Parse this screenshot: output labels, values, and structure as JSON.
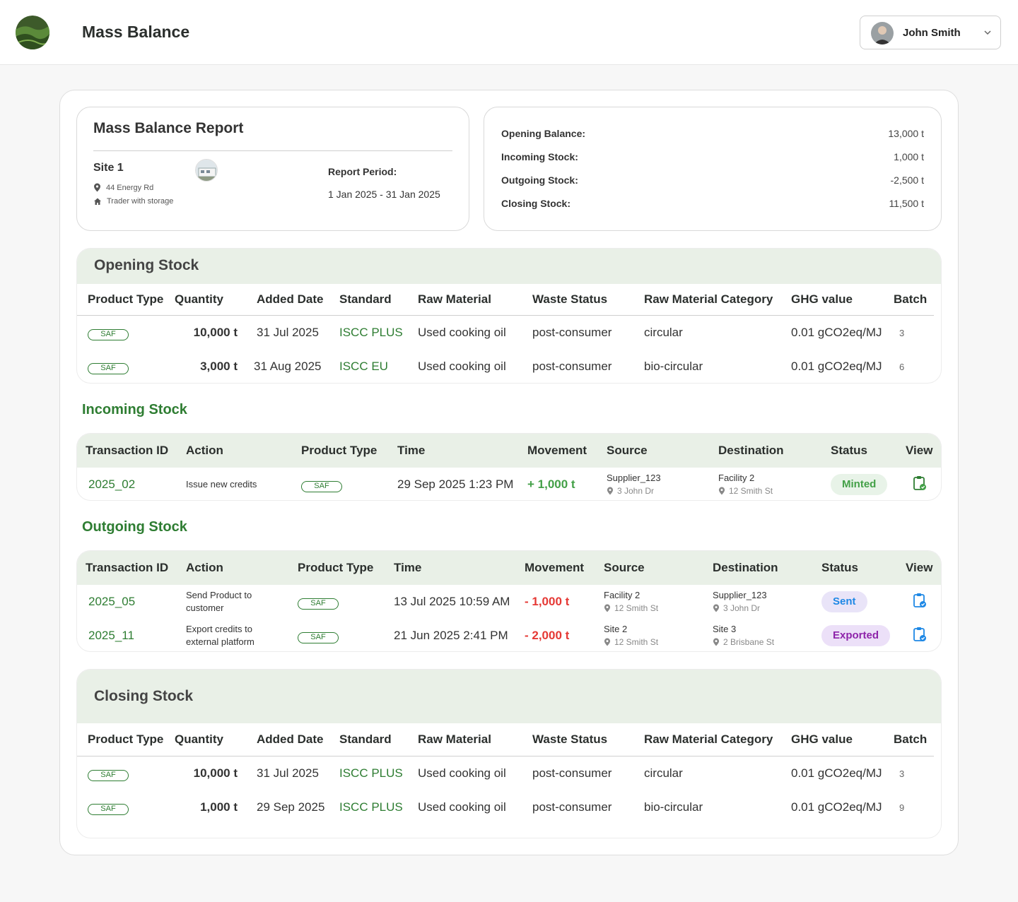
{
  "header": {
    "app_title": "Mass Balance",
    "user_name": "John Smith",
    "logo_icon": "landscape-logo",
    "avatar_icon": "user-avatar"
  },
  "report": {
    "title": "Mass Balance Report",
    "site_name": "Site 1",
    "address": "44 Energy Rd",
    "site_type": "Trader with storage",
    "period_label": "Report Period:",
    "period_value": "1 Jan 2025 - 31 Jan 2025"
  },
  "balance": [
    {
      "label": "Opening Balance:",
      "value": "13,000 t"
    },
    {
      "label": "Incoming Stock:",
      "value": "1,000 t"
    },
    {
      "label": "Outgoing Stock:",
      "value": "-2,500 t"
    },
    {
      "label": "Closing Stock:",
      "value": "11,500 t"
    }
  ],
  "stock_headers": [
    "Product Type",
    "Quantity",
    "Added Date",
    "Standard",
    "Raw Material",
    "Waste Status",
    "Raw Material Category",
    "GHG  value",
    "Batch"
  ],
  "opening": {
    "title": "Opening Stock",
    "rows": [
      {
        "type": "SAF",
        "qty": "10,000 t",
        "date": "31 Jul 2025",
        "standard": "ISCC PLUS",
        "raw": "Used cooking oil",
        "waste": "post-consumer",
        "cat": "circular",
        "ghg": "0.01 gCO2eq/MJ",
        "batch": "3"
      },
      {
        "type": "SAF",
        "qty": "3,000 t",
        "date": "31 Aug 2025",
        "standard": "ISCC EU",
        "raw": "Used cooking oil",
        "waste": "post-consumer",
        "cat": "bio-circular",
        "ghg": "0.01 gCO2eq/MJ",
        "batch": "6"
      }
    ]
  },
  "tx_headers": [
    "Transaction ID",
    "Action",
    "Product Type",
    "Time",
    "Movement",
    "Source",
    "Destination",
    "Status",
    "View"
  ],
  "incoming": {
    "title": "Incoming Stock",
    "rows": [
      {
        "id": "2025_02",
        "action": "Issue new credits",
        "type": "SAF",
        "time": "29 Sep 2025  1:23 PM",
        "movement": "+ 1,000 t",
        "src": "Supplier_123",
        "src_addr": "3 John Dr",
        "dst": "Facility 2",
        "dst_addr": "12 Smith St",
        "status": "Minted"
      }
    ]
  },
  "outgoing": {
    "title": "Outgoing Stock",
    "rows": [
      {
        "id": "2025_05",
        "action": "Send Product to customer",
        "type": "SAF",
        "time": "13 Jul 2025  10:59 AM",
        "movement": "- 1,000 t",
        "src": "Facility 2",
        "src_addr": "12 Smith St",
        "dst": "Supplier_123",
        "dst_addr": "3 John Dr",
        "status": "Sent"
      },
      {
        "id": "2025_11",
        "action": "Export credits to external platform",
        "type": "SAF",
        "time": "21 Jun 2025  2:41 PM",
        "movement": "- 2,000 t",
        "src": "Site 2",
        "src_addr": "12 Smith St",
        "dst": "Site 3",
        "dst_addr": "2 Brisbane St",
        "status": "Exported"
      }
    ]
  },
  "closing": {
    "title": "Closing Stock",
    "rows": [
      {
        "type": "SAF",
        "qty": "10,000 t",
        "date": "31 Jul 2025",
        "standard": "ISCC PLUS",
        "raw": "Used cooking oil",
        "waste": "post-consumer",
        "cat": "circular",
        "ghg": "0.01 gCO2eq/MJ",
        "batch": "3"
      },
      {
        "type": "SAF",
        "qty": "1,000 t",
        "date": "29 Sep 2025",
        "standard": "ISCC PLUS",
        "raw": "Used cooking oil",
        "waste": "post-consumer",
        "cat": "bio-circular",
        "ghg": "0.01 gCO2eq/MJ",
        "batch": "9"
      }
    ]
  },
  "colors": {
    "accent_green": "#2e7d32",
    "header_green": "#e9f0e7",
    "positive": "#43a047",
    "negative": "#e53935"
  }
}
